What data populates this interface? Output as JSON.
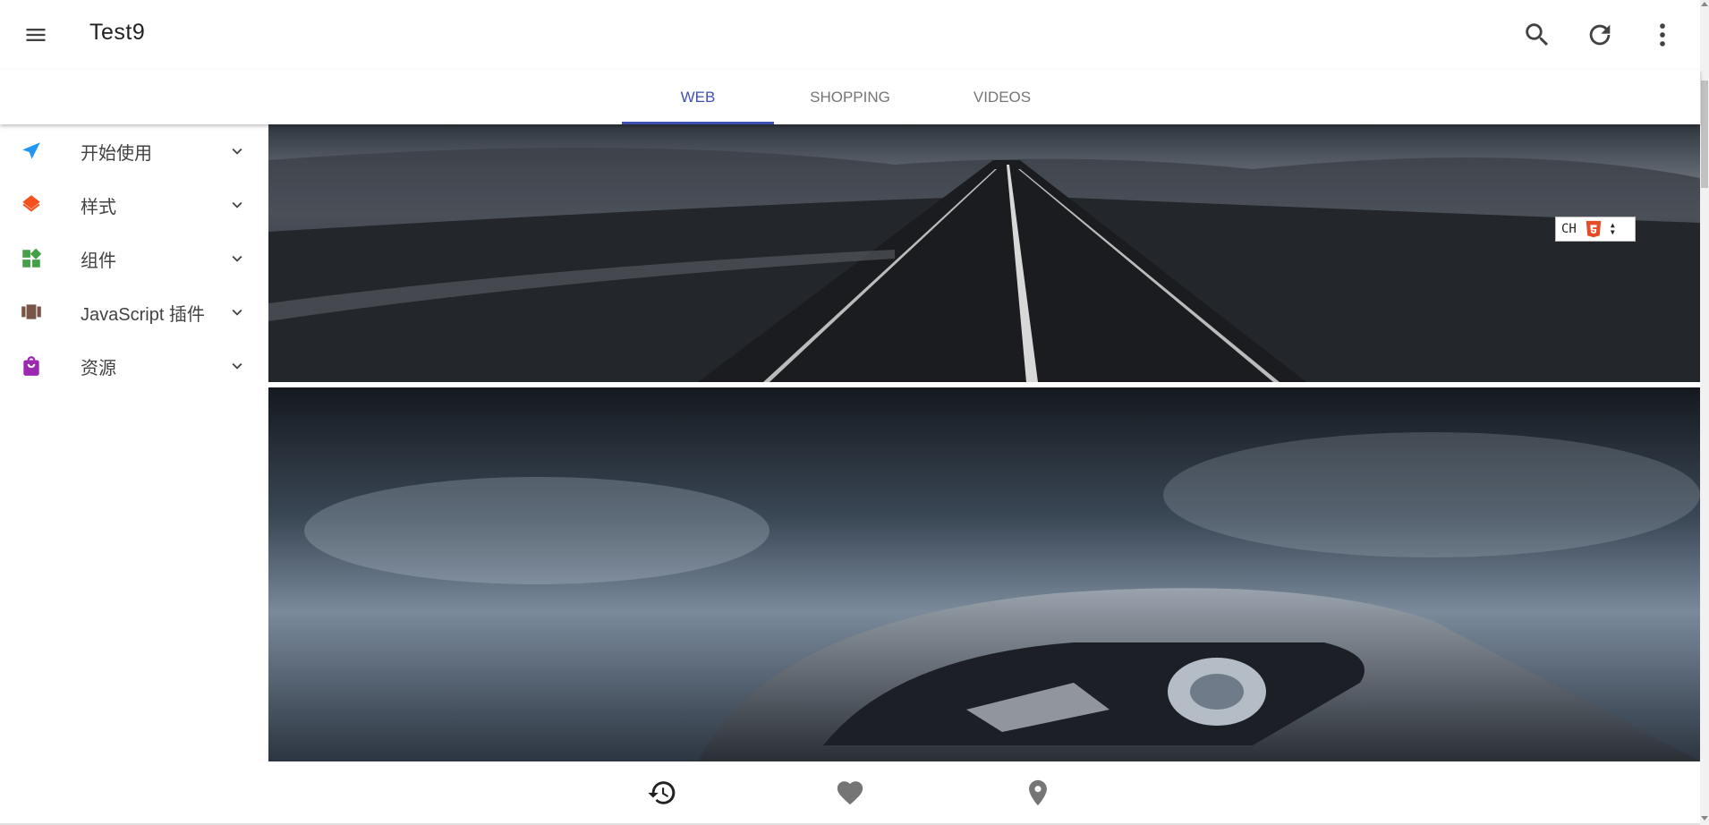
{
  "app": {
    "title": "Test9"
  },
  "tabs": [
    {
      "label": "WEB",
      "active": true
    },
    {
      "label": "SHOPPING",
      "active": false
    },
    {
      "label": "VIDEOS",
      "active": false
    }
  ],
  "toolbar": {
    "icons": [
      "search-icon",
      "refresh-icon",
      "more-vert-icon"
    ]
  },
  "sidebar": {
    "items": [
      {
        "label": "开始使用",
        "icon": "send-icon",
        "color": "#2196f3"
      },
      {
        "label": "样式",
        "icon": "layers-icon",
        "color": "#f4511e"
      },
      {
        "label": "组件",
        "icon": "widgets-icon",
        "color": "#43a047"
      },
      {
        "label": "JavaScript 插件",
        "icon": "view-carousel-icon",
        "color": "#795548"
      },
      {
        "label": "资源",
        "icon": "shopping-bag-icon",
        "color": "#9c27b0"
      }
    ]
  },
  "badge": {
    "text": "CH"
  },
  "bottom_nav": {
    "icons": [
      "history-icon",
      "favorite-icon",
      "location-icon"
    ]
  },
  "colors": {
    "accent": "#3f51b5",
    "text": "#212121",
    "muted": "#757575"
  }
}
